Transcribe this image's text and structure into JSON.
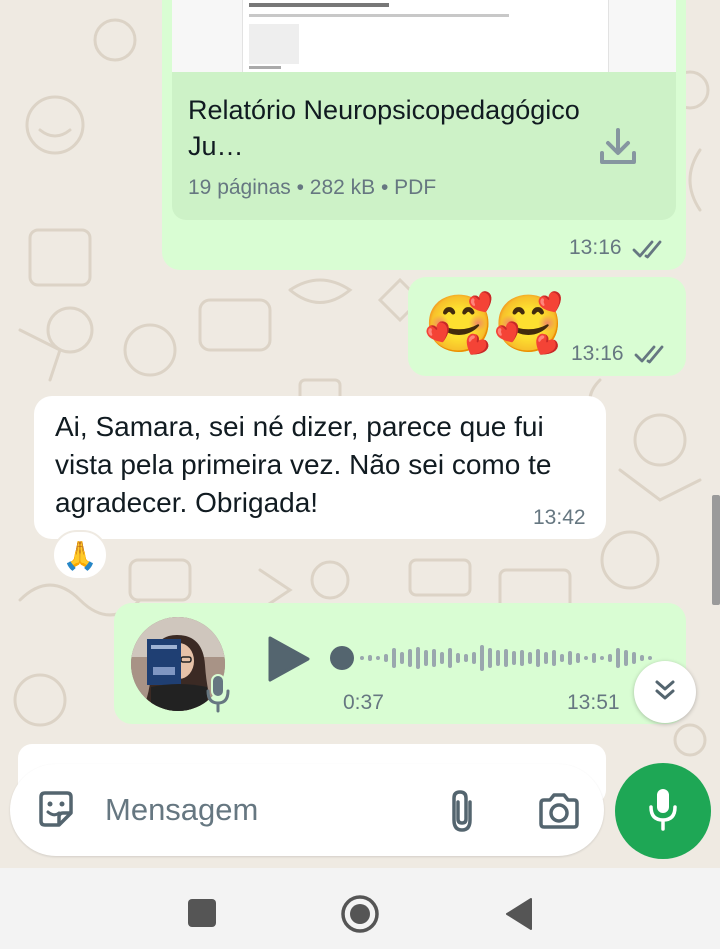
{
  "chat": {
    "document_message": {
      "title": "Relatório Neuropsicopedagógico Ju…",
      "meta": "19 páginas • 282 kB • PDF",
      "time": "13:16",
      "status": "read"
    },
    "emoji_message": {
      "content": "🥰🥰",
      "time": "13:16",
      "status": "read"
    },
    "text_message": {
      "content": "Ai, Samara, sei né dizer, parece que fui vista pela primeira vez. Não sei como te agradecer. Obrigada!",
      "time": "13:42",
      "reaction": "🙏"
    },
    "voice_message": {
      "duration": "0:37",
      "time": "13:51",
      "progress": 0.0
    }
  },
  "composer": {
    "placeholder": "Mensagem"
  },
  "colors": {
    "outgoing_bubble": "#d9fdd3",
    "incoming_bubble": "#ffffff",
    "accent_green": "#1ea755",
    "background": "#efeae2",
    "read_ticks": "#667781"
  },
  "icons": {
    "download": "download-icon",
    "read_ticks": "double-check-icon",
    "play": "play-icon",
    "mic": "mic-icon",
    "sticker": "sticker-icon",
    "attach": "paperclip-icon",
    "camera": "camera-icon",
    "scroll_down": "double-chevron-down-icon",
    "nav_recents": "square-icon",
    "nav_home": "circle-icon",
    "nav_back": "triangle-back-icon"
  }
}
